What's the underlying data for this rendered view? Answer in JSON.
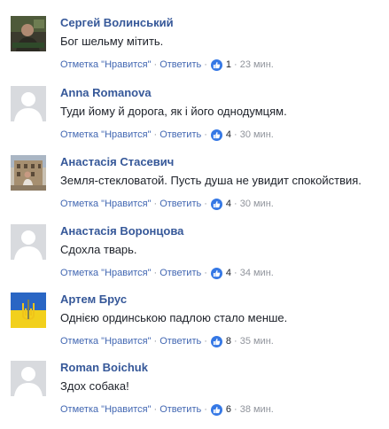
{
  "action_labels": {
    "like": "Отметка \"Нравится\"",
    "reply": "Ответить",
    "separator": "·"
  },
  "colors": {
    "author": "#365899",
    "link": "#4267b2",
    "meta": "#90949c",
    "like_badge": "#3578e5",
    "text": "#1d2129"
  },
  "comments": [
    {
      "author": "Сергей Волинський",
      "text": "Бог шельму мітить.",
      "likes": "1",
      "time": "23 мин.",
      "avatar": "photo-dark"
    },
    {
      "author": "Anna Romanova",
      "text": "Туди йому й дорога, як і його однодумцям.",
      "likes": "4",
      "time": "30 мин.",
      "avatar": "default-silhouette"
    },
    {
      "author": "Анастасія Стасевич",
      "text": "Земля-стекловатой. Пусть душа не увидит спокойствия.",
      "likes": "4",
      "time": "30 мин.",
      "avatar": "photo-building"
    },
    {
      "author": "Анастасія Воронцова",
      "text": "Сдохла тварь.",
      "likes": "4",
      "time": "34 мин.",
      "avatar": "default-silhouette"
    },
    {
      "author": "Артем Брус",
      "text": "Однією ординською падлою стало менше.",
      "likes": "8",
      "time": "35 мин.",
      "avatar": "ukraine-flag-trident"
    },
    {
      "author": "Roman Boichuk",
      "text": "Здох собака!",
      "likes": "6",
      "time": "38 мин.",
      "avatar": "default-silhouette"
    }
  ]
}
